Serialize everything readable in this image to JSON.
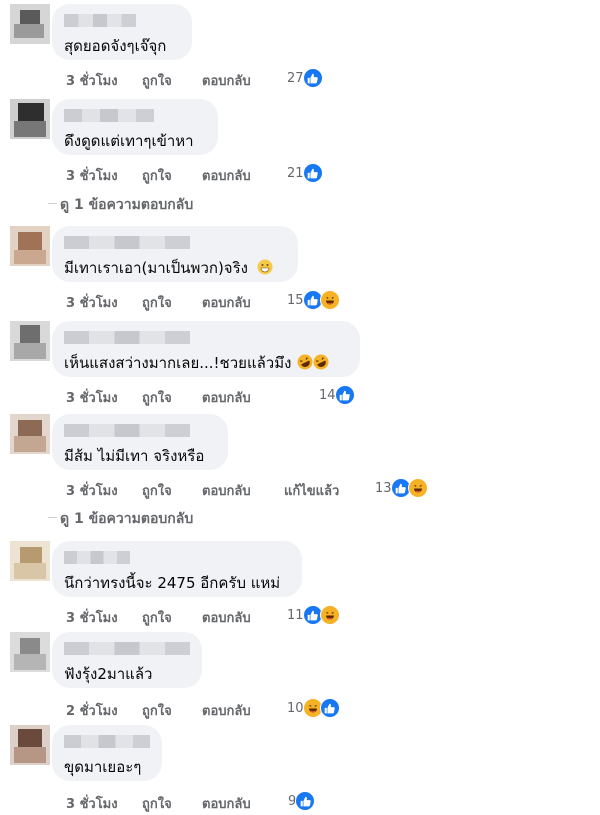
{
  "comments": [
    {
      "text": "สุดยอดจังๆเจ๊จุก",
      "time": "3 ชั่วโมง",
      "like": "ถูกใจ",
      "reply": "ตอบกลับ",
      "edited": "",
      "count": "27",
      "reactions": [
        "like"
      ],
      "replies_link": ""
    },
    {
      "text": "ดึงดูดแต่เทาๆเข้าหา",
      "time": "3 ชั่วโมง",
      "like": "ถูกใจ",
      "reply": "ตอบกลับ",
      "edited": "",
      "count": "21",
      "reactions": [
        "like"
      ],
      "replies_link": "ดู 1 ข้อความตอบกลับ"
    },
    {
      "text": "มีเทาเราเอา(มาเป็นพวก)จริง",
      "time": "3 ชั่วโมง",
      "like": "ถูกใจ",
      "reply": "ตอบกลับ",
      "edited": "",
      "count": "15",
      "reactions": [
        "like",
        "haha"
      ],
      "replies_link": ""
    },
    {
      "text": "เห็นแสงสว่างมากเลย...!ชวยแล้วมึง",
      "time": "3 ชั่วโมง",
      "like": "ถูกใจ",
      "reply": "ตอบกลับ",
      "edited": "",
      "count": "14",
      "reactions": [
        "like"
      ],
      "replies_link": ""
    },
    {
      "text": "มีส้ม ไม่มีเทา จริงหรือ",
      "time": "3 ชั่วโมง",
      "like": "ถูกใจ",
      "reply": "ตอบกลับ",
      "edited": "แก้ไขแล้ว",
      "count": "13",
      "reactions": [
        "like",
        "haha"
      ],
      "replies_link": "ดู 1 ข้อความตอบกลับ"
    },
    {
      "text": "นึกว่าทรงนี้จะ 2475 อีกครับ แหม่",
      "time": "3 ชั่วโมง",
      "like": "ถูกใจ",
      "reply": "ตอบกลับ",
      "edited": "",
      "count": "11",
      "reactions": [
        "like",
        "haha"
      ],
      "replies_link": ""
    },
    {
      "text": "ฟังรุ้ง2มาแล้ว",
      "time": "2 ชั่วโมง",
      "like": "ถูกใจ",
      "reply": "ตอบกลับ",
      "edited": "",
      "count": "10",
      "reactions": [
        "haha",
        "like"
      ],
      "replies_link": ""
    },
    {
      "text": "ขุดมาเยอะๆ",
      "time": "3 ชั่วโมง",
      "like": "ถูกใจ",
      "reply": "ตอบกลับ",
      "edited": "",
      "count": "9",
      "reactions": [
        "like"
      ],
      "replies_link": ""
    }
  ]
}
